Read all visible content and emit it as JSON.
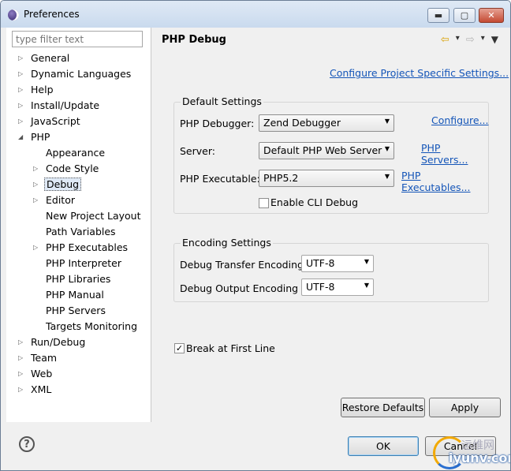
{
  "window": {
    "title": "Preferences"
  },
  "sidebar": {
    "filter_placeholder": "type filter text",
    "items": [
      {
        "label": "General",
        "arrow": "▷"
      },
      {
        "label": "Dynamic Languages",
        "arrow": "▷"
      },
      {
        "label": "Help",
        "arrow": "▷"
      },
      {
        "label": "Install/Update",
        "arrow": "▷"
      },
      {
        "label": "JavaScript",
        "arrow": "▷"
      },
      {
        "label": "PHP",
        "arrow": "◢"
      },
      {
        "label": "Appearance",
        "arrow": ""
      },
      {
        "label": "Code Style",
        "arrow": "▷"
      },
      {
        "label": "Debug",
        "arrow": "▷"
      },
      {
        "label": "Editor",
        "arrow": "▷"
      },
      {
        "label": "New Project Layout",
        "arrow": ""
      },
      {
        "label": "Path Variables",
        "arrow": ""
      },
      {
        "label": "PHP Executables",
        "arrow": "▷"
      },
      {
        "label": "PHP Interpreter",
        "arrow": ""
      },
      {
        "label": "PHP Libraries",
        "arrow": ""
      },
      {
        "label": "PHP Manual",
        "arrow": ""
      },
      {
        "label": "PHP Servers",
        "arrow": ""
      },
      {
        "label": "Targets Monitoring",
        "arrow": ""
      },
      {
        "label": "Run/Debug",
        "arrow": "▷"
      },
      {
        "label": "Team",
        "arrow": "▷"
      },
      {
        "label": "Web",
        "arrow": "▷"
      },
      {
        "label": "XML",
        "arrow": "▷"
      }
    ]
  },
  "main": {
    "title": "PHP Debug",
    "configure_project_link": "Configure Project Specific Settings...",
    "default_settings": {
      "title": "Default Settings",
      "debugger_label": "PHP Debugger:",
      "debugger_value": "Zend Debugger",
      "debugger_link": "Configure...",
      "server_label": "Server:",
      "server_value": "Default PHP Web Server",
      "server_link": "PHP Servers...",
      "executable_label": "PHP Executable:",
      "executable_value": "PHP5.2",
      "executable_link": "PHP Executables...",
      "cli_debug_label": "Enable CLI Debug"
    },
    "encoding_settings": {
      "title": "Encoding Settings",
      "transfer_label": "Debug Transfer Encoding",
      "transfer_value": "UTF-8",
      "output_label": "Debug Output Encoding",
      "output_value": "UTF-8"
    },
    "break_first_line_label": "Break at First Line",
    "restore_defaults_label": "Restore Defaults",
    "apply_label": "Apply"
  },
  "footer": {
    "ok_label": "OK",
    "cancel_label": "Cancel"
  },
  "watermark": {
    "line1": "运维网",
    "line2": "iyunv.com"
  },
  "icons": {
    "back": "arrow-left-icon",
    "forward": "arrow-right-icon",
    "menu": "view-menu-icon",
    "help": "help-icon"
  }
}
